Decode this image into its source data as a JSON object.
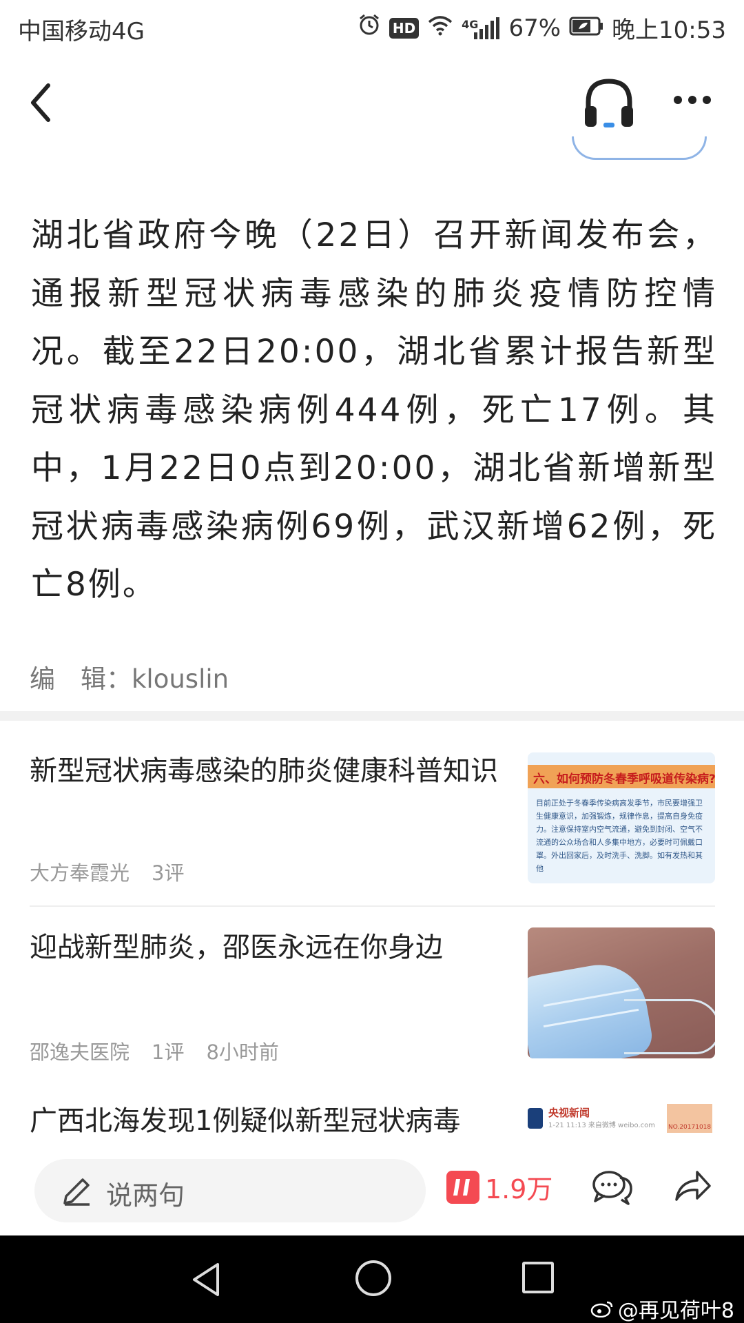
{
  "status_bar": {
    "carrier": "中国移动4G",
    "network": "4G",
    "battery": "67%",
    "time": "晚上10:53",
    "hd_label": "HD"
  },
  "nav": {
    "back_icon": "chevron-left-icon",
    "audio_icon": "headphones-icon",
    "more_icon": "more-dots-icon"
  },
  "article": {
    "body": "湖北省政府今晚（22日）召开新闻发布会，通报新型冠状病毒感染的肺炎疫情防控情况。截至22日20:00，湖北省累计报告新型冠状病毒感染病例444例，死亡17例。其中，1月22日0点到20:00，湖北省新增新型冠状病毒感染病例69例，武汉新增62例，死亡8例。",
    "editor_label": "编　辑：",
    "editor_name": "klouslin"
  },
  "related": [
    {
      "title": "新型冠状病毒感染的肺炎健康科普知识",
      "source": "大方奉霞光",
      "comments": "3评",
      "time": "",
      "thumb_header": "六、如何预防冬春季呼吸道传染病?",
      "thumb_text": "目前正处于冬春季传染病高发季节，市民要增强卫生健康意识，加强锻炼，规律作息，提高自身免疫力。注意保持室内空气流通，避免到封闭、空气不流通的公众场合和人多集中地方，必要时可佩戴口罩。外出回家后，及时洗手、洗脚。如有发热和其他"
    },
    {
      "title": "迎战新型肺炎，邵医永远在你身边",
      "source": "邵逸夫医院",
      "comments": "1评",
      "time": "8小时前"
    },
    {
      "title": "广西北海发现1例疑似新型冠状病毒",
      "thumb_source": "央视新闻",
      "thumb_date": "1-21 11:13 来自微博 weibo.com",
      "thumb_stamp": "NO.20171018"
    }
  ],
  "bottom_bar": {
    "comment_placeholder": "说两句",
    "like_count": "1.9万"
  },
  "watermark": "@再见荷叶8",
  "colors": {
    "accent_red": "#f44a52",
    "meta_gray": "#999999",
    "text_dark": "#222222"
  }
}
